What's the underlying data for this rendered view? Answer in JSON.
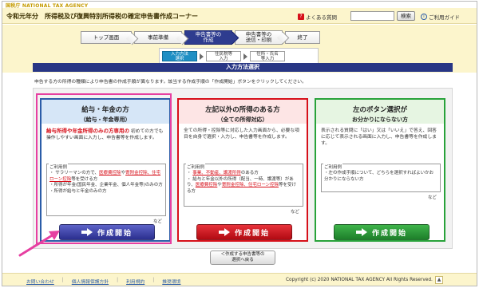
{
  "header": {
    "agency_logo": "国税庁 NATIONAL TAX AGENCY",
    "page_title": "令和元年分　所得税及び復興特別所得税の確定申告書作成コーナー",
    "faq_label": "よくある質問",
    "search_placeholder": "",
    "search_button": "検索",
    "guide_label": "ご利用ガイド"
  },
  "steps": [
    {
      "label": "トップ画面"
    },
    {
      "label": "事前準備"
    },
    {
      "label": "申告書等の作成",
      "line1": "申告書等の",
      "line2": "作成"
    },
    {
      "label": "申告書等の送信・印刷",
      "line1": "申告書等の",
      "line2": "送信・印刷"
    },
    {
      "label": "終了"
    }
  ],
  "substeps": [
    {
      "line1": "入力方法",
      "line2": "選択"
    },
    {
      "line1": "住民税等",
      "line2": "入力"
    },
    {
      "line1": "住所・氏名",
      "line2": "等入力"
    }
  ],
  "section_title": "入力方法選択",
  "instruction": "申告する方の所得の種類により申告書の作成手順が異なります。該当する作成手順の「作成開始」ボタンをクリックしてください。",
  "cards": [
    {
      "title1": "給与・年金の方",
      "title2": "（給与・年金専用）",
      "desc_red": "給与所得や年金所得のみの方専用の",
      "desc_rest": "初めての方でも操作しやすい画面に入力し、申告書等を作成します。",
      "example_label": "ご利用例",
      "examples": [
        {
          "pre": "サラリーマンの方で、",
          "link1": "医療費控除",
          "mid": "や",
          "link2": "寄附金控除、住宅ローン控除",
          "post": "等を受ける方"
        },
        {
          "pre": "所得が年金(国民年金、企業年金、個人年金等)のみの方",
          "link1": "",
          "mid": "",
          "link2": "",
          "post": ""
        },
        {
          "pre": "所得が給与と年金のみの方",
          "link1": "",
          "mid": "",
          "link2": "",
          "post": ""
        }
      ],
      "nado": "など",
      "button": "作成開始"
    },
    {
      "title1": "左記以外の所得のある方",
      "title2": "（全ての所得対応）",
      "desc_red": "",
      "desc_rest": "全ての所得・控除等に対応した入力画面から、必要な項目を自身で選択・入力し、申告書等を作成します。",
      "example_label": "ご利用例",
      "examples": [
        {
          "pre": "",
          "link1": "事業、不動産、譲渡所得",
          "mid": "",
          "link2": "",
          "post": "のある方"
        },
        {
          "pre": "給与と年金以外の所得（配当、一時、譲渡等）があり、",
          "link1": "医療費控除",
          "mid": "や",
          "link2": "寄附金控除、住宅ローン控除",
          "post": "等を受ける方"
        }
      ],
      "nado": "など",
      "button": "作成開始"
    },
    {
      "title1": "左のボタン選択が",
      "title2": "お分かりにならない方",
      "desc_red": "",
      "desc_rest": "表示される質問に「はい」又は「いいえ」で答え、回答に応じて表示される画面に入力し、申告書等を作成します。",
      "example_label": "ご利用例",
      "examples": [
        {
          "pre": "左の作成手順について、どちらを選択すればよいかお分かりにならない方",
          "link1": "",
          "mid": "",
          "link2": "",
          "post": ""
        }
      ],
      "nado": "など",
      "button": "作成開始"
    }
  ],
  "back_button": {
    "line1": "＜作成する申告書等の",
    "line2": "選択へ戻る"
  },
  "footer": {
    "links": [
      "お問い合わせ",
      "個人情報保護方針",
      "利用規約",
      "推奨環境"
    ],
    "copyright": "Copyright (c) 2020 NATIONAL TAX AGENCY All Rights Reserved.",
    "pagetop": "▲"
  },
  "colors": {
    "header_bg": "#fcf5cc",
    "section_bar": "#283685",
    "card_blue": "#2b5ca8",
    "card_red": "#d6101a",
    "card_green": "#28a23a",
    "highlight": "#e63fa1"
  }
}
